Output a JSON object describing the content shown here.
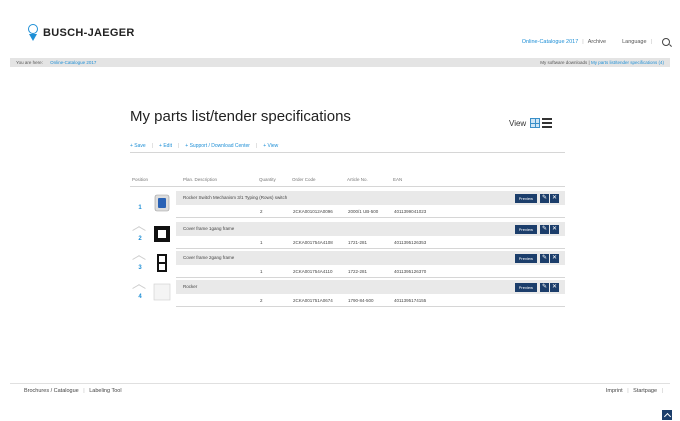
{
  "header": {
    "brand": "BUSCH-JAEGER",
    "nav": [
      "Online-Catalogue 2017",
      "Archive"
    ],
    "language": "Language"
  },
  "breadcrumb": {
    "prefix": "You are here:",
    "current": "Online-Catalogue 2017",
    "right_link1": "My software downloads",
    "right_link2": "My parts list/tender specifications (4)"
  },
  "main": {
    "title": "My parts list/tender specifications",
    "view_label": "View",
    "actions": [
      "+ Save",
      "+ Edit",
      "+ Support / Download Center",
      "+ View"
    ],
    "columns": [
      "Position",
      "Plan. Description",
      "Quantity",
      "Order Code",
      "Article No.",
      "EAN"
    ],
    "preview_label": "Preview",
    "rows": [
      {
        "pos": "1",
        "desc": "Rocker Switch Mechanism 3/1 Typing (Rows) switch",
        "qty": "2",
        "order": "2CKA001012A0096",
        "article": "2000/1 UB-500",
        "ean": "4011399041023"
      },
      {
        "pos": "2",
        "desc": "Cover frame 1gang frame",
        "qty": "1",
        "order": "2CKA001754A4108",
        "article": "1721-281",
        "ean": "4011395126353"
      },
      {
        "pos": "3",
        "desc": "Cover frame 2gang frame",
        "qty": "1",
        "order": "2CKA001754A4110",
        "article": "1722-281",
        "ean": "4011395126370"
      },
      {
        "pos": "4",
        "desc": "Rocker",
        "qty": "2",
        "order": "2CKA001751A0674",
        "article": "1790-84-500",
        "ean": "4011395174155"
      }
    ]
  },
  "footer": {
    "left": [
      "Brochures / Catalogue",
      "Labeling Tool"
    ],
    "right": [
      "Imprint",
      "Startpage"
    ]
  },
  "colors": {
    "accent": "#1e8fd6",
    "button": "#1c3e6b",
    "rowbg": "#e9e9e9"
  }
}
